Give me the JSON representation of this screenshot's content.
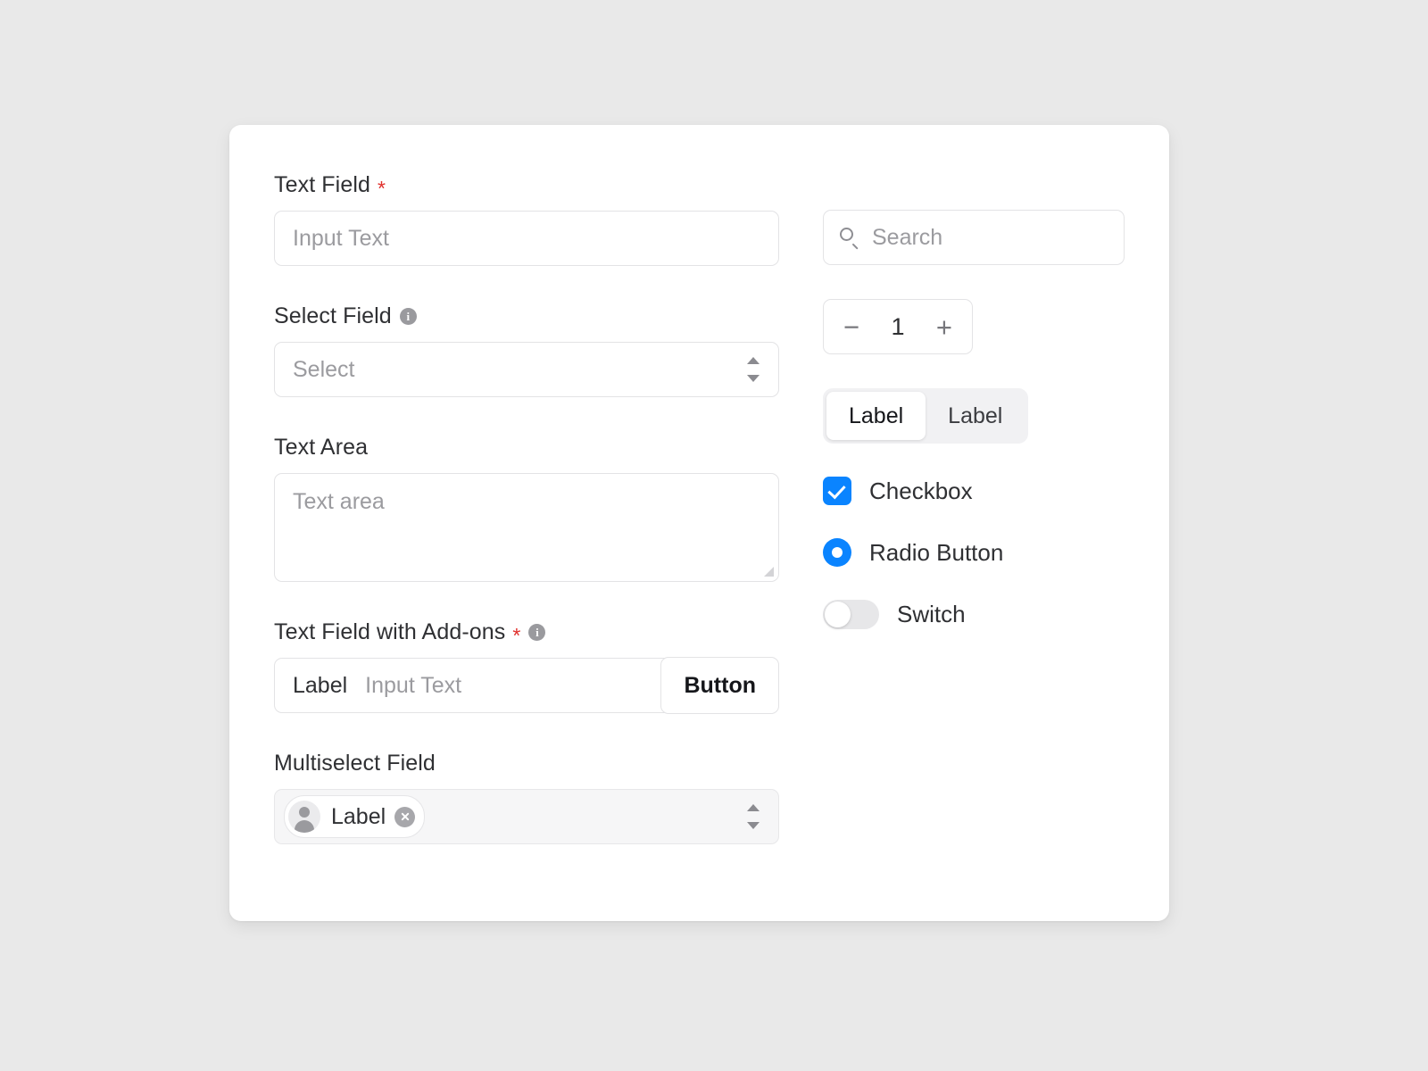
{
  "card": {
    "accent_blue": "#0A84FF",
    "required_color": "#E0302C",
    "background": "#E9E9E9",
    "surface": "#FFFFFF"
  },
  "left_column": {
    "text_field": {
      "label": "Text Field",
      "required_marker": "*",
      "placeholder": "Input Text"
    },
    "select_field": {
      "label": "Select Field",
      "info_icon": "info-icon",
      "placeholder": "Select"
    },
    "text_area": {
      "label": "Text Area",
      "placeholder": "Text area"
    },
    "text_field_addons": {
      "label": "Text Field with Add-ons",
      "required_marker": "*",
      "info_icon": "info-icon",
      "prefix_label": "Label",
      "placeholder": "Input Text",
      "button_label": "Button"
    },
    "multiselect_field": {
      "label": "Multiselect Field",
      "chips": [
        {
          "label": "Label",
          "avatar_icon": "person-avatar-icon",
          "remove_icon": "close-circle-icon"
        }
      ]
    }
  },
  "right_column": {
    "search": {
      "icon": "search-icon",
      "placeholder": "Search"
    },
    "stepper": {
      "decrement_label": "−",
      "value": "1",
      "increment_label": "+"
    },
    "segmented_control": {
      "options": [
        {
          "label": "Label",
          "selected": true
        },
        {
          "label": "Label",
          "selected": false
        }
      ]
    },
    "checkbox": {
      "label": "Checkbox",
      "checked": true
    },
    "radio": {
      "label": "Radio Button",
      "selected": true
    },
    "switch": {
      "label": "Switch",
      "on": false
    }
  }
}
